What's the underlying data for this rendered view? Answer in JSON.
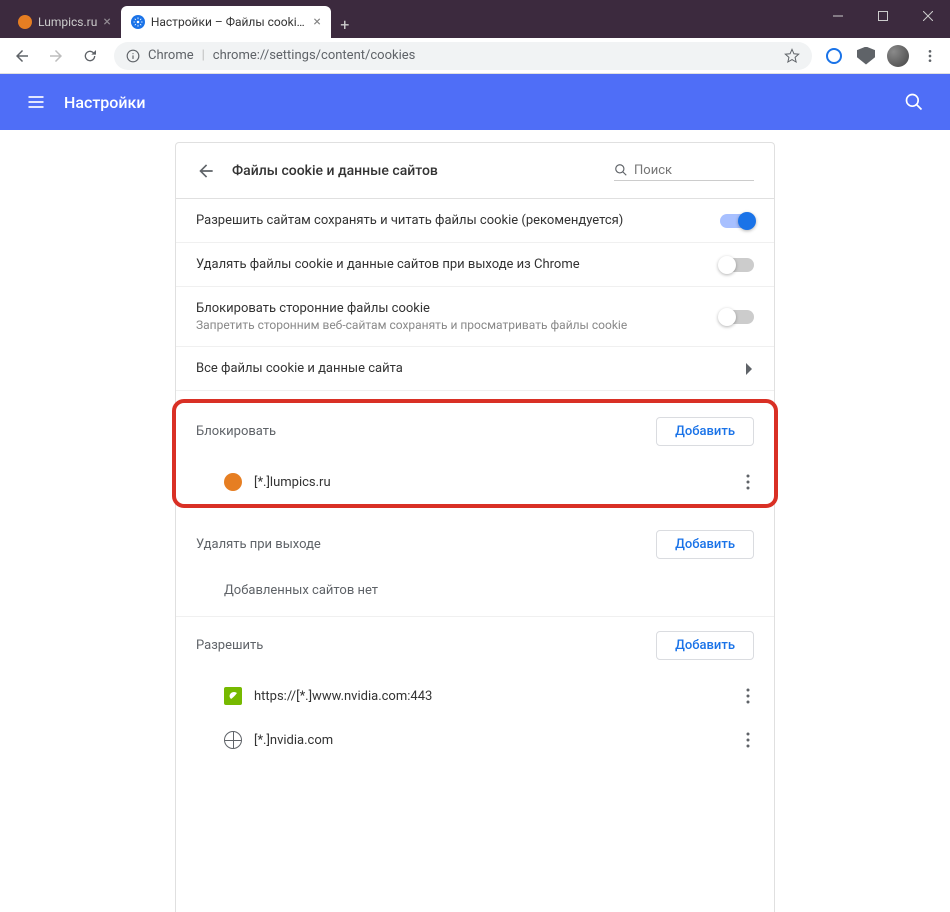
{
  "tabs": [
    {
      "title": "Lumpics.ru",
      "active": false,
      "favicon_color": "#e67e22"
    },
    {
      "title": "Настройки – Файлы cookie и да",
      "active": true,
      "favicon_color": "#1a73e8"
    }
  ],
  "omnibox": {
    "chrome_label": "Chrome",
    "url": "chrome://settings/content/cookies"
  },
  "header": {
    "title": "Настройки"
  },
  "page": {
    "title": "Файлы cookie и данные сайтов",
    "search_placeholder": "Поиск"
  },
  "toggles": [
    {
      "title": "Разрешить сайтам сохранять и читать файлы cookie (рекомендуется)",
      "sub": "",
      "on": true
    },
    {
      "title": "Удалять файлы cookie и данные сайтов при выходе из Chrome",
      "sub": "",
      "on": false
    },
    {
      "title": "Блокировать сторонние файлы cookie",
      "sub": "Запретить сторонним веб-сайтам сохранять и просматривать файлы cookie",
      "on": false
    }
  ],
  "all_cookies_label": "Все файлы cookie и данные сайта",
  "sections": {
    "block": {
      "title": "Блокировать",
      "add_label": "Добавить",
      "items": [
        {
          "url": "[*.]lumpics.ru",
          "favicon_color": "#e67e22",
          "icon_type": "circle"
        }
      ]
    },
    "clear_on_exit": {
      "title": "Удалять при выходе",
      "add_label": "Добавить",
      "empty_text": "Добавленных сайтов нет"
    },
    "allow": {
      "title": "Разрешить",
      "add_label": "Добавить",
      "items": [
        {
          "url": "https://[*.]www.nvidia.com:443",
          "icon_type": "nvidia"
        },
        {
          "url": "[*.]nvidia.com",
          "icon_type": "globe"
        }
      ]
    }
  }
}
